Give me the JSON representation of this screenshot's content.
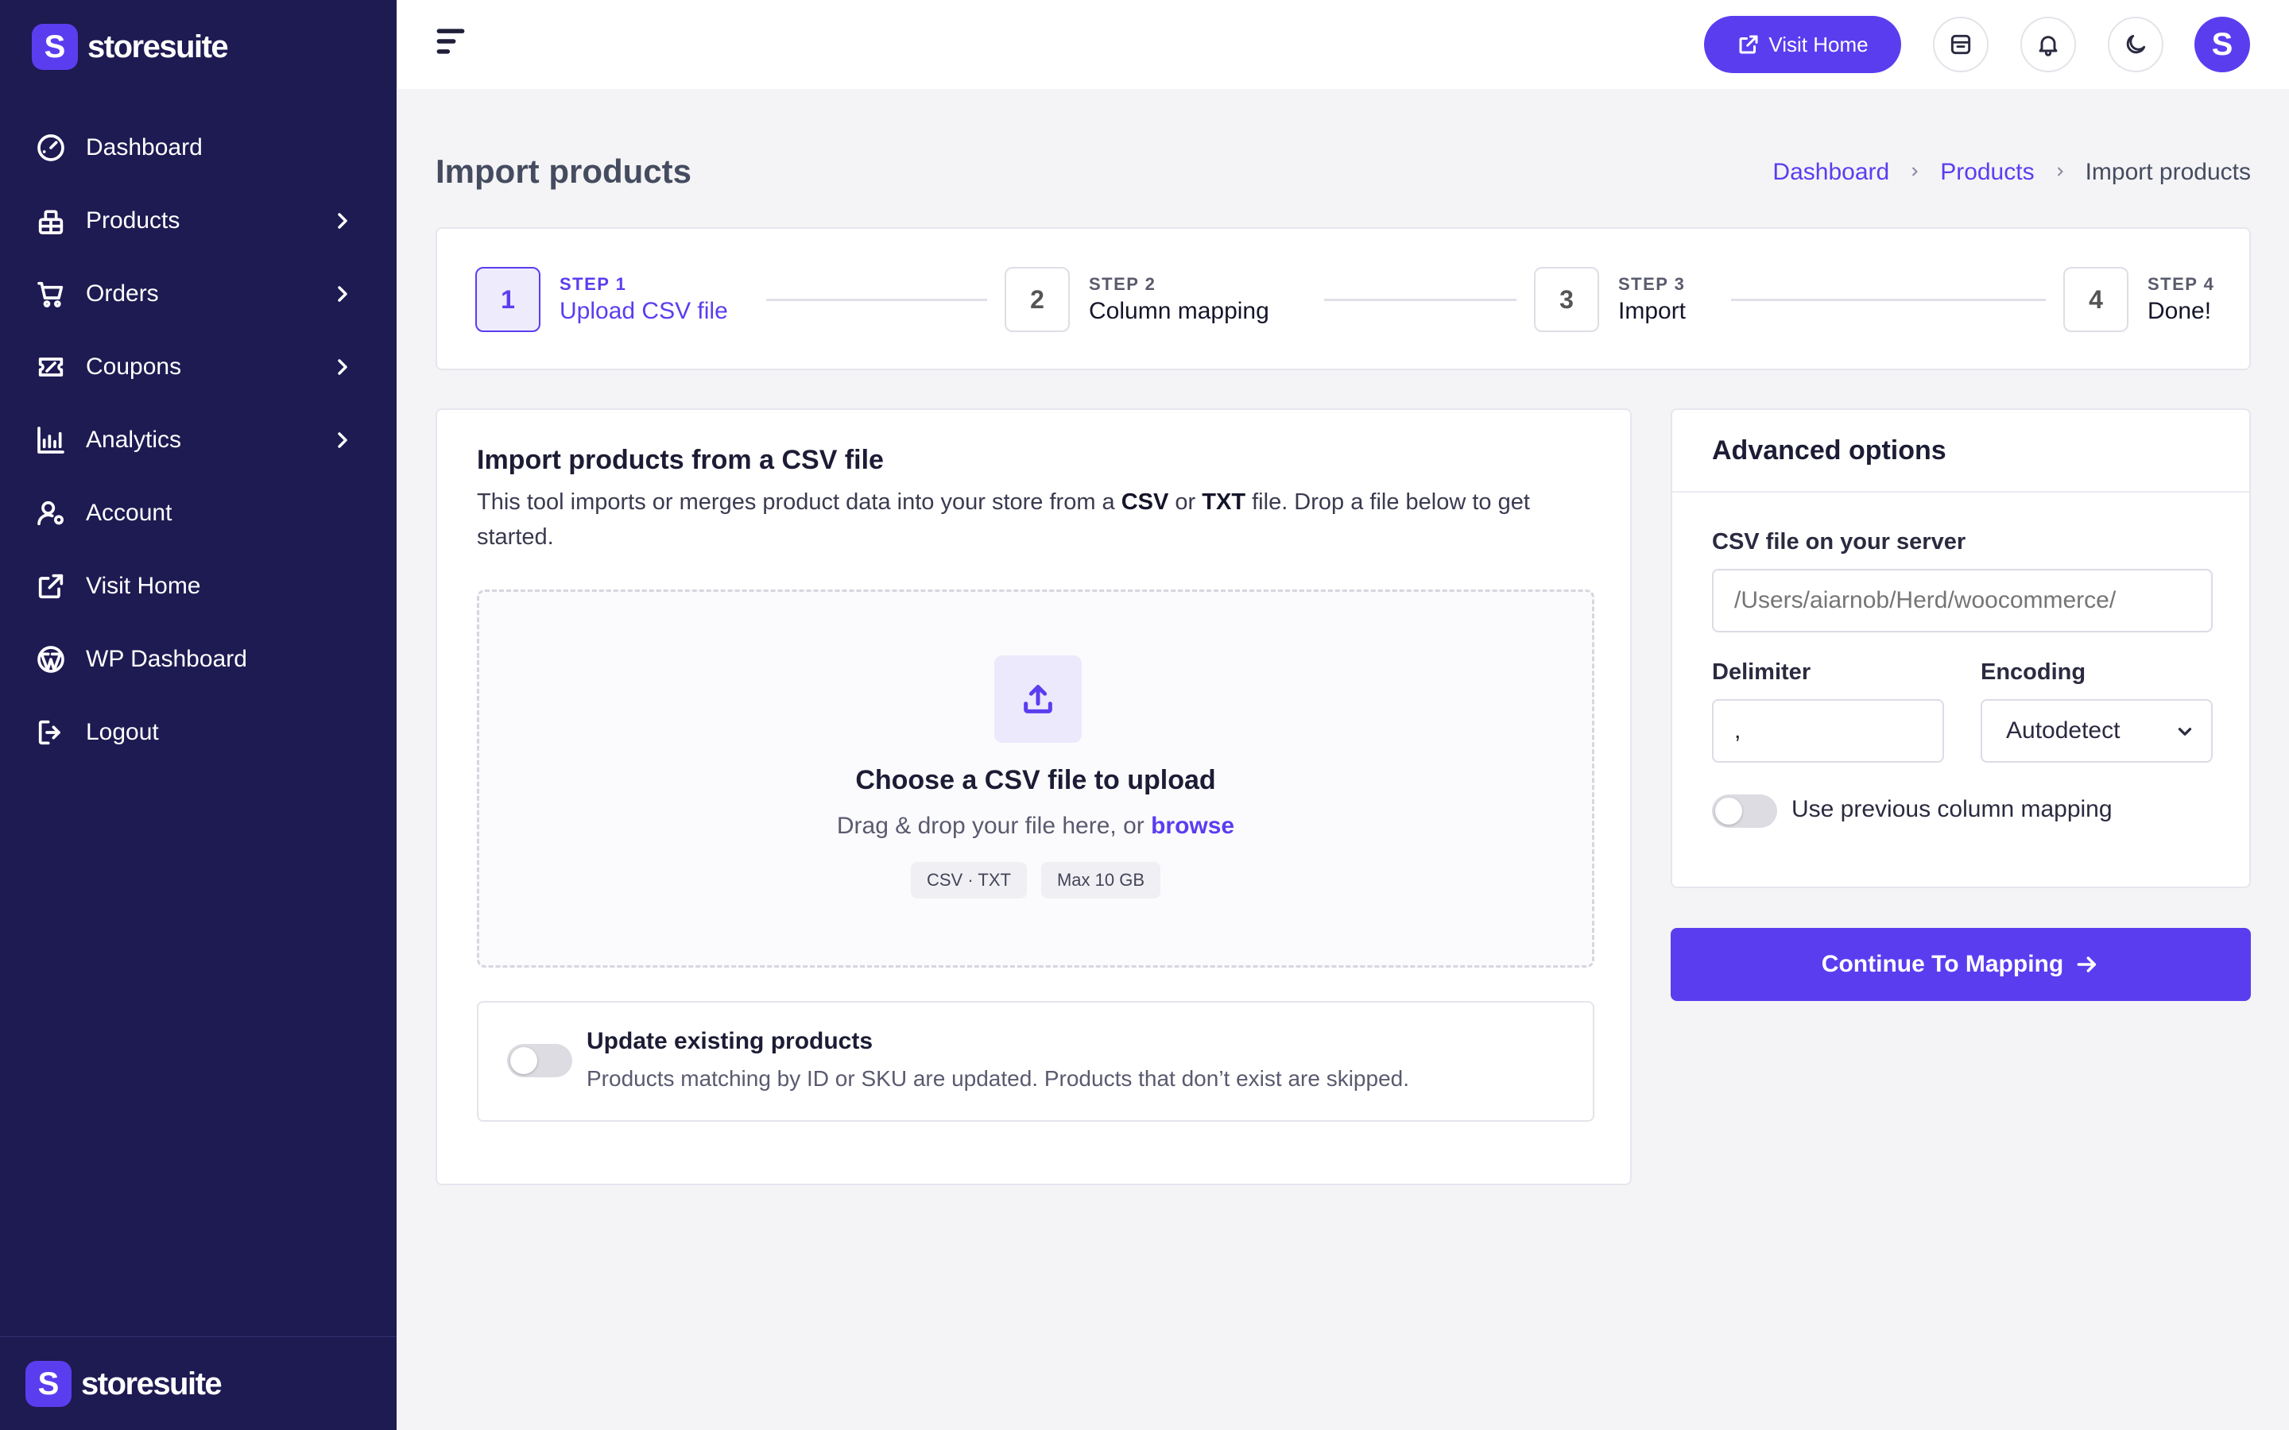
{
  "brand": {
    "name": "storesuite",
    "logo_letter": "S",
    "accent": "#5b3df0",
    "sidebar_bg": "#1e1a52"
  },
  "sidebar": {
    "items": [
      {
        "label": "Dashboard",
        "icon": "gauge-icon",
        "has_submenu": false
      },
      {
        "label": "Products",
        "icon": "package-icon",
        "has_submenu": true
      },
      {
        "label": "Orders",
        "icon": "cart-icon",
        "has_submenu": true
      },
      {
        "label": "Coupons",
        "icon": "ticket-icon",
        "has_submenu": true
      },
      {
        "label": "Analytics",
        "icon": "chart-icon",
        "has_submenu": true
      },
      {
        "label": "Account",
        "icon": "user-gear-icon",
        "has_submenu": false
      },
      {
        "label": "Visit Home",
        "icon": "external-link-icon",
        "has_submenu": false
      },
      {
        "label": "WP Dashboard",
        "icon": "wordpress-icon",
        "has_submenu": false
      },
      {
        "label": "Logout",
        "icon": "logout-icon",
        "has_submenu": false
      }
    ]
  },
  "topbar": {
    "visit_home_label": "Visit Home",
    "avatar_letter": "S"
  },
  "page": {
    "title": "Import products",
    "breadcrumb": [
      "Dashboard",
      "Products",
      "Import products"
    ]
  },
  "stepper": {
    "steps": [
      {
        "number": "1",
        "kicker": "STEP 1",
        "title": "Upload CSV file",
        "active": true
      },
      {
        "number": "2",
        "kicker": "STEP 2",
        "title": "Column mapping",
        "active": false
      },
      {
        "number": "3",
        "kicker": "STEP 3",
        "title": "Import",
        "active": false
      },
      {
        "number": "4",
        "kicker": "STEP 4",
        "title": "Done!",
        "active": false
      }
    ]
  },
  "main": {
    "heading": "Import products from a CSV file",
    "desc_pre": "This tool imports or merges product data into your store from a ",
    "desc_csv": "CSV",
    "desc_or": " or ",
    "desc_txt": "TXT",
    "desc_post": " file. Drop a file below to get started.",
    "dropzone": {
      "title": "Choose a CSV file to upload",
      "sub_pre": "Drag & drop your file here, or ",
      "browse": "browse",
      "chips": [
        "CSV · TXT",
        "Max 10 GB"
      ]
    },
    "update": {
      "title": "Update existing products",
      "desc": "Products matching by ID or SKU are updated. Products that don’t exist are skipped.",
      "enabled": false
    }
  },
  "advanced": {
    "title": "Advanced options",
    "server_label": "CSV file on your server",
    "server_placeholder": "/Users/aiarnob/Herd/woocommerce/",
    "delimiter_label": "Delimiter",
    "delimiter_value": ",",
    "encoding_label": "Encoding",
    "encoding_value": "Autodetect",
    "mapping_label": "Use previous column mapping",
    "mapping_enabled": false
  },
  "continue_label": "Continue To Mapping"
}
